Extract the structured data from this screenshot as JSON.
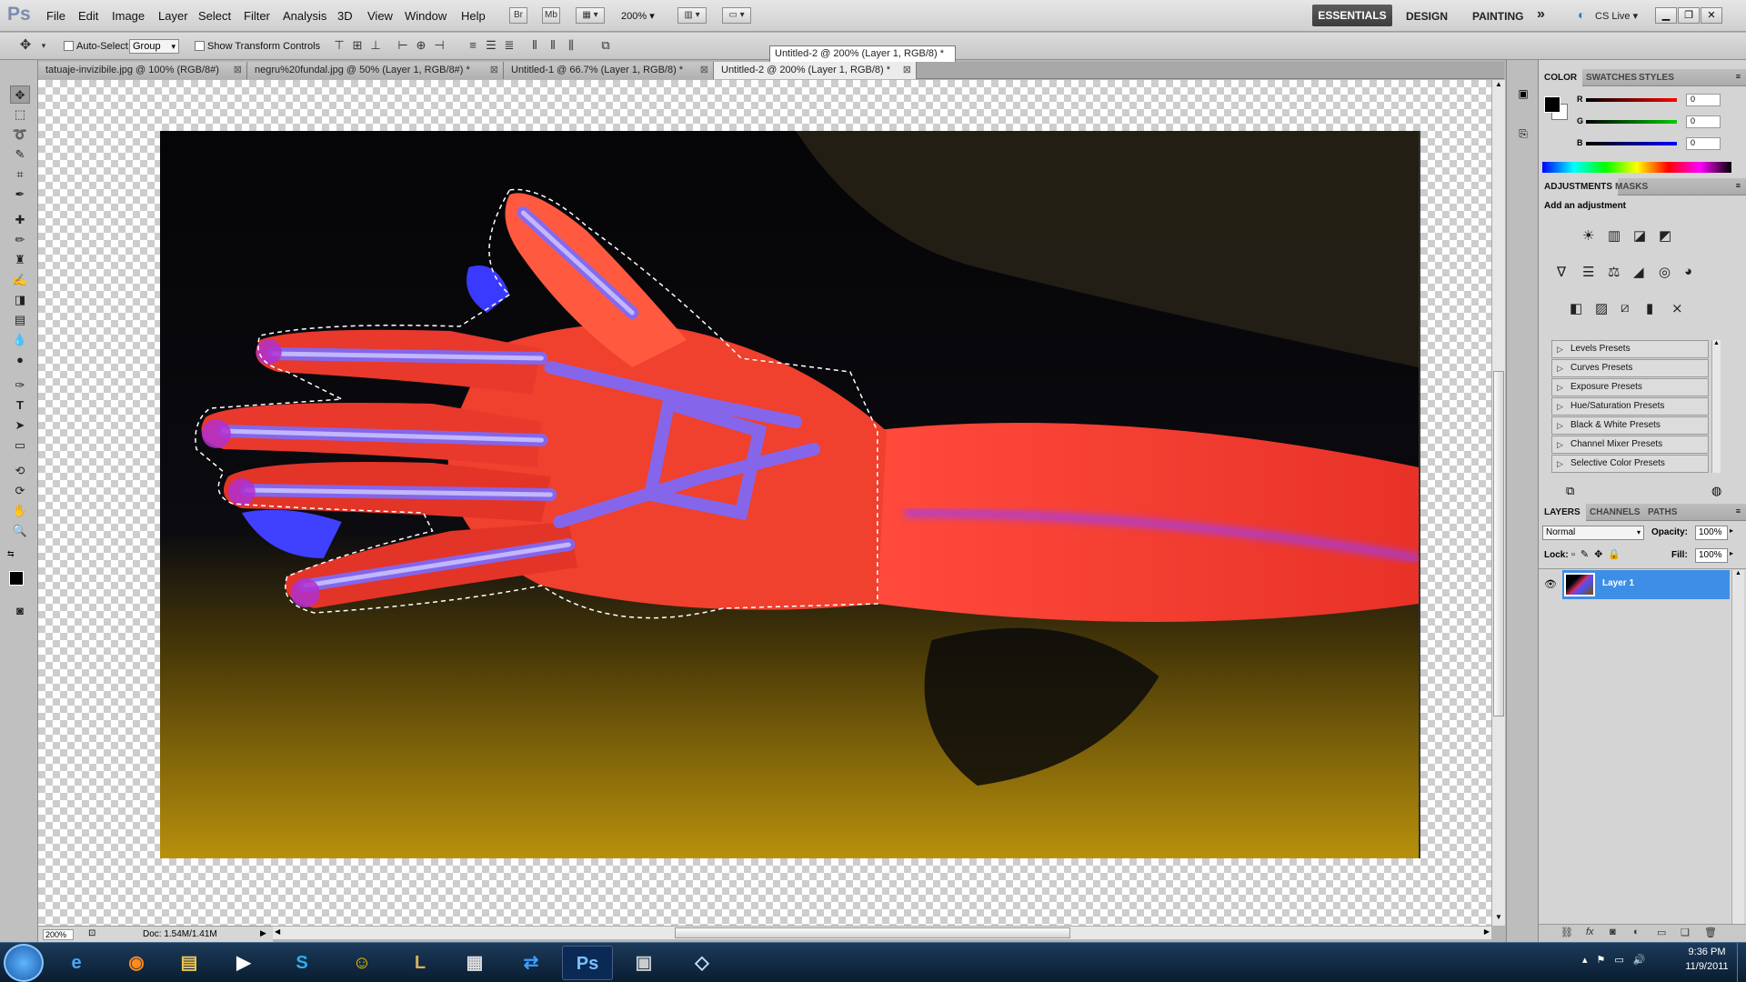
{
  "app": {
    "logo": "Ps"
  },
  "menus": [
    "File",
    "Edit",
    "Image",
    "Layer",
    "Select",
    "Filter",
    "Analysis",
    "3D",
    "View",
    "Window",
    "Help"
  ],
  "appbar": {
    "bridge": "Br",
    "minibridge": "Mb",
    "zoom": "200%"
  },
  "workspaces": {
    "active": "ESSENTIALS",
    "items": [
      "DESIGN",
      "PAINTING"
    ],
    "more": "»",
    "cs_live": "CS Live"
  },
  "options": {
    "auto_select_label": "Auto-Select:",
    "auto_select_value": "Group",
    "transform_label": "Show Transform Controls"
  },
  "tooltip": "Untitled-2 @ 200% (Layer 1, RGB/8) *",
  "tabs": [
    {
      "label": "tatuaje-invizibile.jpg @ 100% (RGB/8#)"
    },
    {
      "label": "negru%20fundal.jpg @ 50% (Layer 1, RGB/8#) *"
    },
    {
      "label": "Untitled-1 @ 66.7% (Layer 1, RGB/8) *"
    },
    {
      "label": "Untitled-2 @ 200% (Layer 1, RGB/8) *"
    }
  ],
  "status": {
    "zoom": "200%",
    "doc": "Doc: 1.54M/1.41M"
  },
  "color_panel": {
    "tabs": [
      "COLOR",
      "SWATCHES",
      "STYLES"
    ],
    "channels": [
      {
        "label": "R",
        "value": "0"
      },
      {
        "label": "G",
        "value": "0"
      },
      {
        "label": "B",
        "value": "0"
      }
    ]
  },
  "adjustments_panel": {
    "tabs": [
      "ADJUSTMENTS",
      "MASKS"
    ],
    "heading": "Add an adjustment",
    "presets": [
      "Levels Presets",
      "Curves Presets",
      "Exposure Presets",
      "Hue/Saturation Presets",
      "Black & White Presets",
      "Channel Mixer Presets",
      "Selective Color Presets"
    ]
  },
  "layers_panel": {
    "tabs": [
      "LAYERS",
      "CHANNELS",
      "PATHS"
    ],
    "blend_mode": "Normal",
    "opacity_label": "Opacity:",
    "opacity": "100%",
    "lock_label": "Lock:",
    "fill_label": "Fill:",
    "fill": "100%",
    "layer_name": "Layer 1"
  },
  "taskbar": {
    "time": "9:36 PM",
    "date": "11/9/2011"
  }
}
